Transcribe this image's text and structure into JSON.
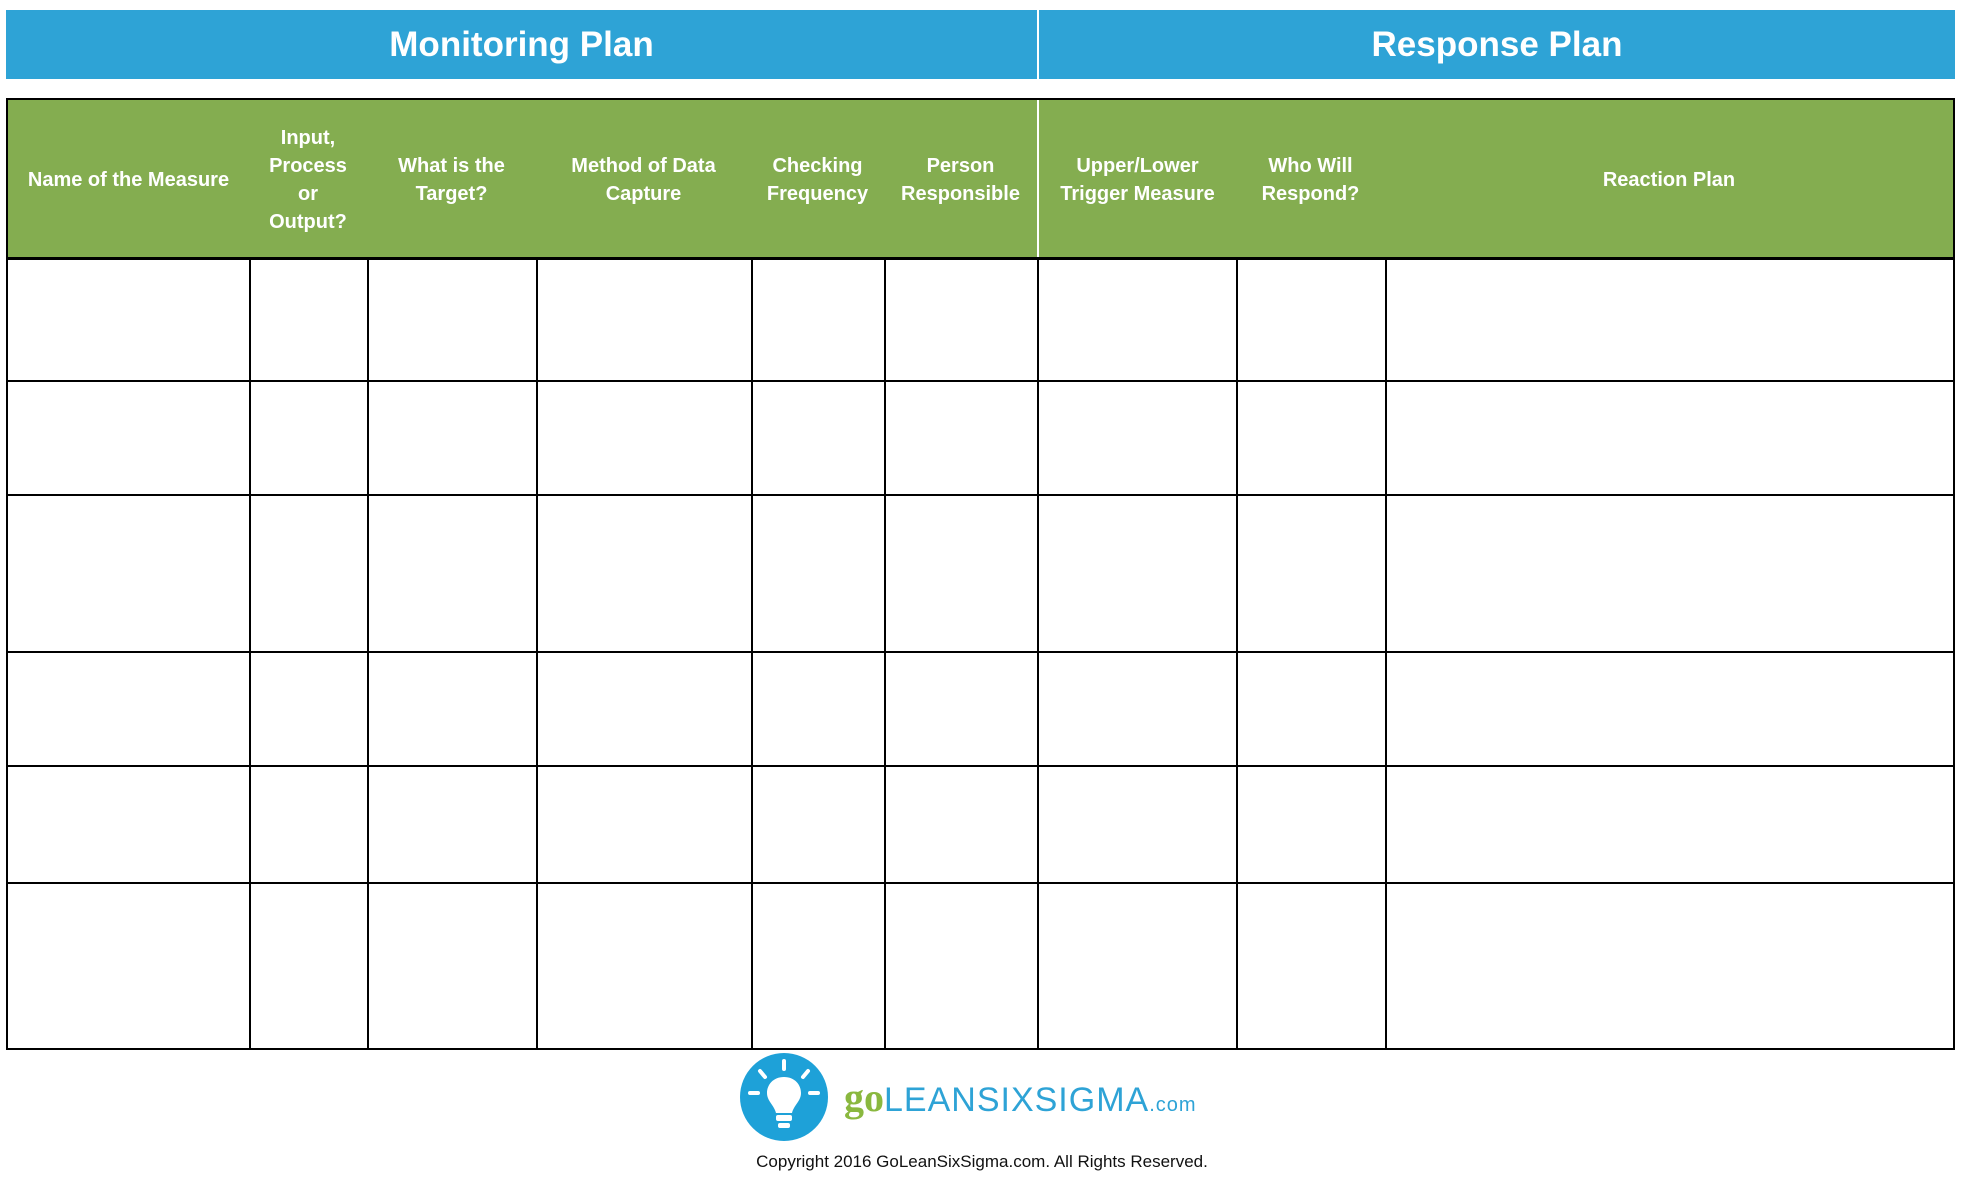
{
  "sections": {
    "monitoring": "Monitoring Plan",
    "response": "Response Plan"
  },
  "columns": [
    "Name of the Measure",
    "Input, Process or Output?",
    "What is the Target?",
    "Method of Data Capture",
    "Checking Frequency",
    "Person Responsible",
    "Upper/Lower Trigger Measure",
    "Who Will Respond?",
    "Reaction Plan"
  ],
  "column_lines": [
    [
      "Name of the Measure"
    ],
    [
      "Input,",
      "Process",
      "or",
      "Output?"
    ],
    [
      "What is the",
      "Target?"
    ],
    [
      "Method of Data",
      "Capture"
    ],
    [
      "Checking",
      "Frequency"
    ],
    [
      "Person",
      "Responsible"
    ],
    [
      "Upper/Lower",
      "Trigger Measure"
    ],
    [
      "Who Will",
      "Respond?"
    ],
    [
      "Reaction Plan"
    ]
  ],
  "rows": [
    [
      "",
      "",
      "",
      "",
      "",
      "",
      "",
      "",
      ""
    ],
    [
      "",
      "",
      "",
      "",
      "",
      "",
      "",
      "",
      ""
    ],
    [
      "",
      "",
      "",
      "",
      "",
      "",
      "",
      "",
      ""
    ],
    [
      "",
      "",
      "",
      "",
      "",
      "",
      "",
      "",
      ""
    ],
    [
      "",
      "",
      "",
      "",
      "",
      "",
      "",
      "",
      ""
    ],
    [
      "",
      "",
      "",
      "",
      "",
      "",
      "",
      "",
      ""
    ]
  ],
  "footer": {
    "logo_go": "go",
    "logo_name": "LEANSIXSIGMA",
    "logo_tld": ".com",
    "copyright": "Copyright 2016 GoLeanSixSigma.com. All Rights Reserved."
  },
  "colors": {
    "section_band": "#2ea3d6",
    "header_fill": "#84ad50",
    "logo_green": "#8ab83f"
  }
}
